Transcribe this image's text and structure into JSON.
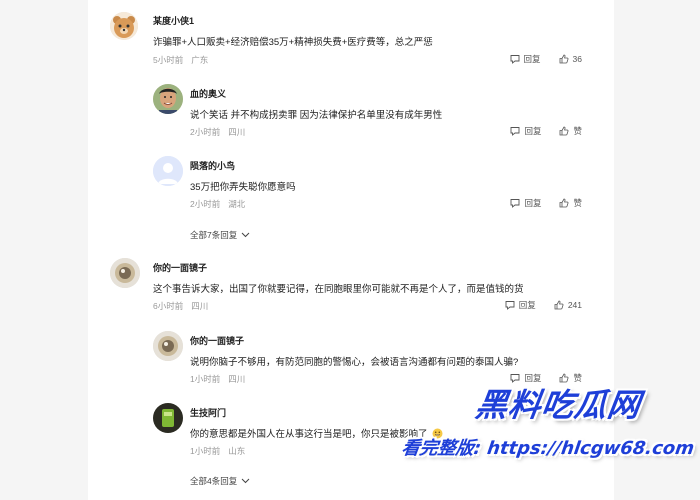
{
  "comments": [
    {
      "username": "某度小侠1",
      "text": "诈骗罪+人口贩卖+经济赔偿35万+精神损失费+医疗费等，总之严惩",
      "time": "5小时前",
      "location": "广东",
      "reply_label": "回复",
      "likes": "36",
      "avatar_icon": "bear-avatar-icon"
    },
    {
      "username": "血的奥义",
      "text": "说个笑话 并不构成拐卖罪 因为法律保护名单里没有成年男性",
      "time": "2小时前",
      "location": "四川",
      "reply_label": "回复",
      "likes": "赞",
      "avatar_icon": "man-avatar-icon"
    },
    {
      "username": "陨落的小鸟",
      "text": "35万把你弄失聪你愿意吗",
      "time": "2小时前",
      "location": "湖北",
      "reply_label": "回复",
      "likes": "赞",
      "avatar_icon": "default-avatar-icon"
    },
    {
      "username": "你的一面镜子",
      "text": "这个事告诉大家，出国了你就要记得，在同胞眼里你可能就不再是个人了，而是值钱的货",
      "time": "6小时前",
      "location": "四川",
      "reply_label": "回复",
      "likes": "241",
      "avatar_icon": "mirror-avatar-icon"
    },
    {
      "username": "你的一面镜子",
      "text": "说明你脑子不够用，有防范同胞的警惕心，会被语言沟通都有问题的泰国人骗?",
      "time": "1小时前",
      "location": "四川",
      "reply_label": "回复",
      "likes": "赞",
      "avatar_icon": "mirror-avatar-icon"
    },
    {
      "username": "生技阿门",
      "text": "你的意思都是外国人在从事这行当是吧，你只是被影响了",
      "time": "1小时前",
      "location": "山东",
      "reply_label": "回复",
      "likes": "赞",
      "avatar_icon": "green-avatar-icon"
    }
  ],
  "more_replies": [
    {
      "label": "全部7条回复"
    },
    {
      "label": "全部4条回复"
    }
  ],
  "watermark": {
    "title": "黑料吃瓜网",
    "subtitle": "看完整版: https://hlcgw68.com"
  },
  "colors": {
    "accent": "#1e3fd8",
    "meta": "#999999"
  }
}
